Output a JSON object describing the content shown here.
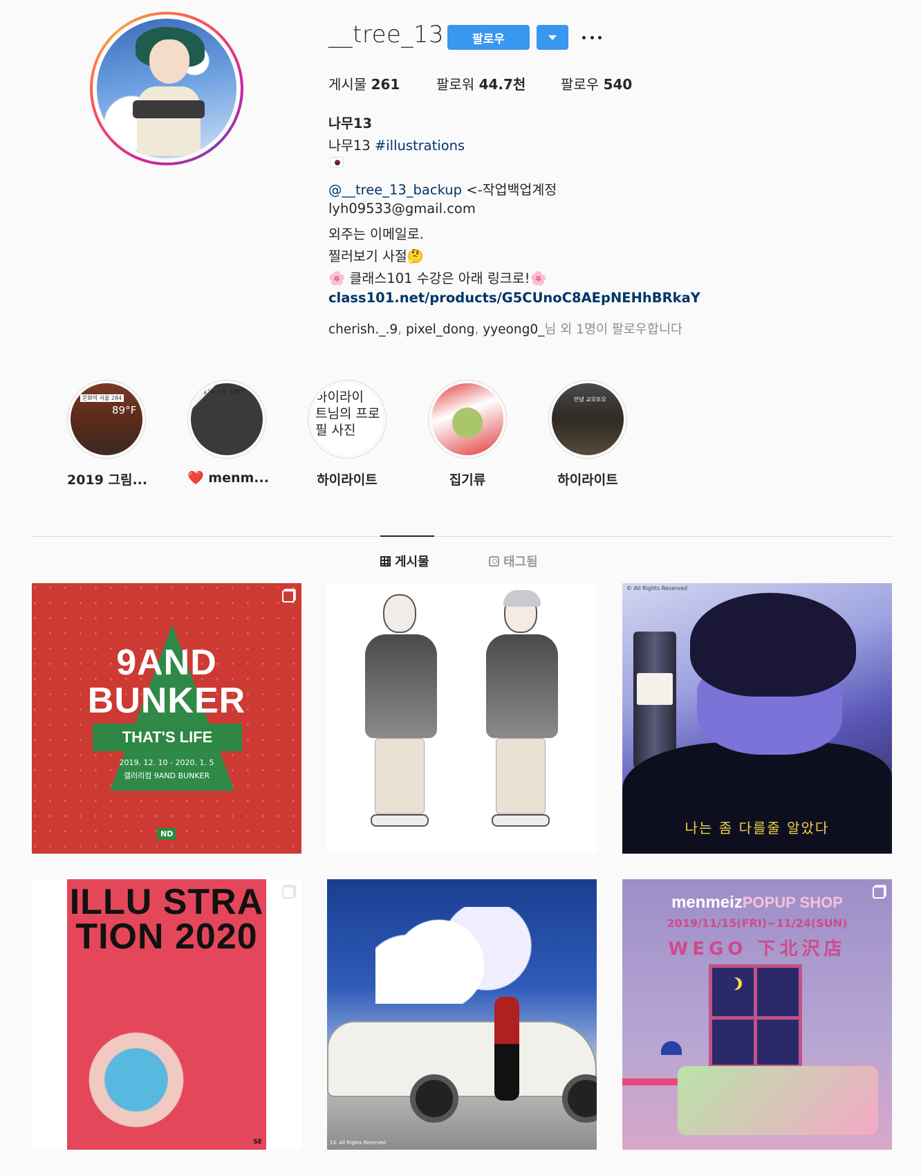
{
  "profile": {
    "username": "__tree_13",
    "follow_label": "팔로우",
    "stats": {
      "posts_label": "게시물",
      "posts_value": "261",
      "followers_label": "팔로워",
      "followers_value": "44.7천",
      "following_label": "팔로우",
      "following_value": "540"
    },
    "bio": {
      "name": "나무13",
      "line1_text": "나무13",
      "line1_hashtag": "#illustrations",
      "backup_handle": "@__tree_13_backup",
      "backup_note": "<-작업백업계정",
      "email": "lyh09533@gmail.com",
      "commission_note": "외주는 이메일로.",
      "nudge_note": "찔러보기 사절🤔",
      "class_note": "🌸 클래스101 수강은 아래 링크로!🌸",
      "link": "class101.net/products/G5CUnoC8AEpNEHhBRkaY"
    },
    "mutual": {
      "user1": "cherish._.9",
      "user2": "pixel_dong",
      "user3": "yyeong0_",
      "suffix": "님 외 1명이 팔로우합니다"
    }
  },
  "highlights": [
    {
      "label": "2019 그림...",
      "inner_text": "89°F",
      "sticker": "문화역 서울 284"
    },
    {
      "label": "❤️ menm...",
      "inner_text": "I'm in TOKY"
    },
    {
      "label": "하이라이트",
      "inner_text": "하이라이\n트님의 프로\n필 사진"
    },
    {
      "label": "집기류"
    },
    {
      "label": "하이라이트",
      "inner_text": "안녕 교오또오"
    }
  ],
  "tabs": {
    "posts_label": "게시물",
    "tagged_label": "태그됨"
  },
  "posts": {
    "p1": {
      "line1": "9AND",
      "line2": "BUNKER",
      "banner": "THAT'S LIFE",
      "date": "2019. 12. 10 - 2020. 1. 5",
      "venue": "갤러리컴 9AND BUNKER",
      "badge": "ND"
    },
    "p3": {
      "caption": "나는 좀 다를줄 알았다",
      "copyright": "© All Rights Reserved"
    },
    "p4": {
      "title": "ILLU STRA TION 2020",
      "badge": "SE"
    },
    "p5": {
      "copyright": "13. All Rights Reserved"
    },
    "p6": {
      "brand": "menmeiz",
      "popup": "POPUP SHOP",
      "dates": "2019/11/15(FRI)~11/24(SUN)",
      "store": "WEGO 下北沢店"
    }
  },
  "colors": {
    "accent": "#3897f0",
    "link": "#003569",
    "muted": "#8e8e8e",
    "text": "#262626"
  }
}
